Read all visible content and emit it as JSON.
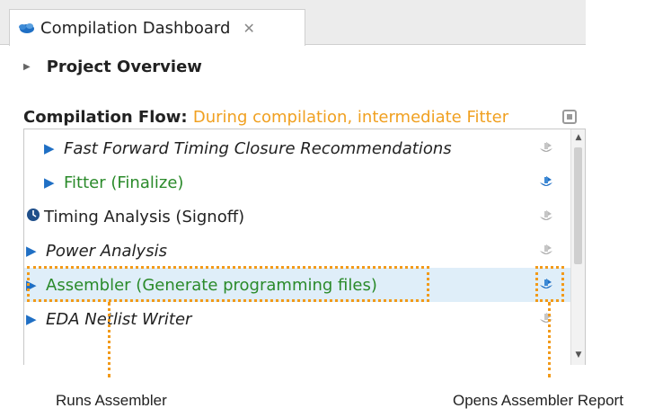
{
  "tab": {
    "title": "Compilation Dashboard",
    "close_glyph": "✕"
  },
  "overview": {
    "label": "Project Overview"
  },
  "flow": {
    "label": "Compilation Flow",
    "separator": ": ",
    "status": "During compilation, intermediate Fitter"
  },
  "tasks": [
    {
      "label": "Fast Forward Timing Closure Recommendations",
      "style": "italic",
      "icon": "report-icon-gray"
    },
    {
      "label": "Fitter (Finalize)",
      "style": "green",
      "icon": "report-icon-blue"
    },
    {
      "label": "Timing Analysis (Signoff)",
      "style": "dark",
      "icon": "report-icon-gray"
    },
    {
      "label": "Power Analysis",
      "style": "italic",
      "icon": "report-icon-gray"
    },
    {
      "label": "Assembler (Generate programming files)",
      "style": "green",
      "icon": "report-icon-blue"
    },
    {
      "label": "EDA Netlist Writer",
      "style": "italic",
      "icon": "report-icon-gray"
    }
  ],
  "callouts": {
    "runs": "Runs Assembler",
    "opens": "Opens Assembler Report"
  },
  "colors": {
    "accent_blue": "#1f6fc4",
    "status_orange": "#f0a020",
    "done_green": "#2a8a2a",
    "callout_orange": "#f29a1a"
  }
}
